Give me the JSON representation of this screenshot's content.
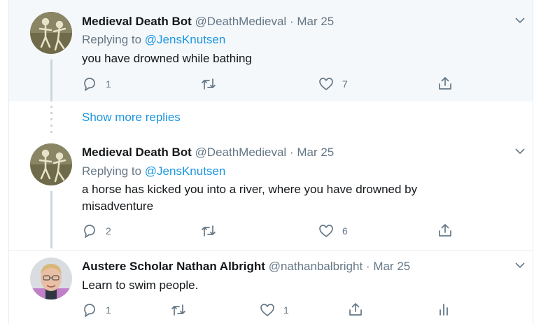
{
  "replies": [
    {
      "name": "Medieval Death Bot",
      "handle": "@DeathMedieval",
      "separator": "·",
      "date": "Mar 25",
      "replying_prefix": "Replying to",
      "replying_to": "@JensKnutsen",
      "text": "you have drowned while bathing",
      "reply_count": "1",
      "retweet_count": "",
      "like_count": "7",
      "avatar_icon": "skeleton-artwork-avatar"
    },
    {
      "name": "Medieval Death Bot",
      "handle": "@DeathMedieval",
      "separator": "·",
      "date": "Mar 25",
      "replying_prefix": "Replying to",
      "replying_to": "@JensKnutsen",
      "text": "a horse has kicked you into a river, where you have drowned by misadventure",
      "reply_count": "2",
      "retweet_count": "",
      "like_count": "6",
      "avatar_icon": "skeleton-artwork-avatar"
    },
    {
      "name": "Austere Scholar Nathan Albright",
      "handle": "@nathanbalbright",
      "separator": "·",
      "date": "Mar 25",
      "text": "Learn to swim people.",
      "reply_count": "1",
      "retweet_count": "",
      "like_count": "1",
      "avatar_icon": "person-photo-avatar"
    }
  ],
  "show_more_replies": "Show more replies",
  "colors": {
    "link": "#1b95e0",
    "muted": "#657786",
    "highlight_bg": "#f5f8fa",
    "thread_line": "#ccd6dd"
  }
}
